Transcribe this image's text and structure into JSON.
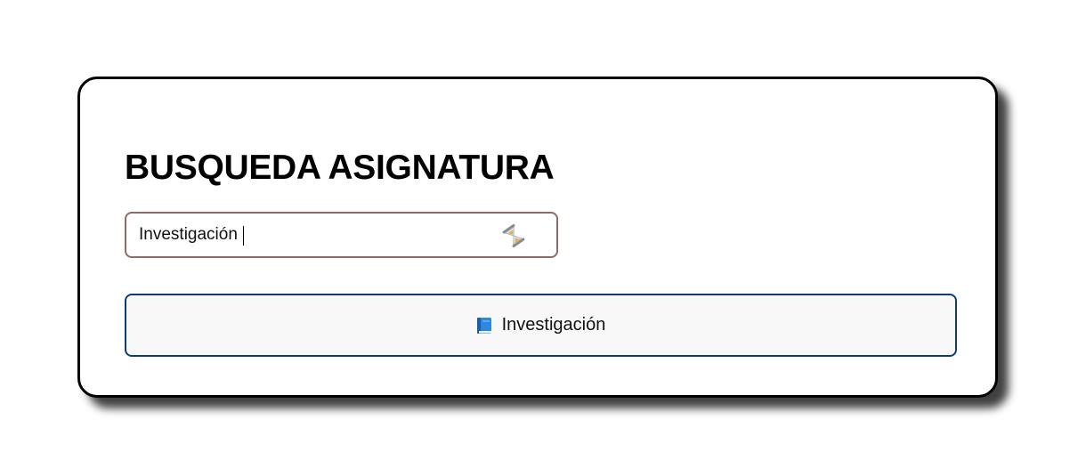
{
  "page": {
    "title": "BUSQUEDA ASIGNATURA"
  },
  "search": {
    "value": "Investigación",
    "loading_icon": "hourglass-icon"
  },
  "results": [
    {
      "label": "Investigación",
      "icon": "blue-book-icon"
    }
  ],
  "colors": {
    "card_border": "#000000",
    "search_border": "#8f6a6a",
    "result_border": "#0f3d6e",
    "result_background": "#f8f8f8"
  }
}
